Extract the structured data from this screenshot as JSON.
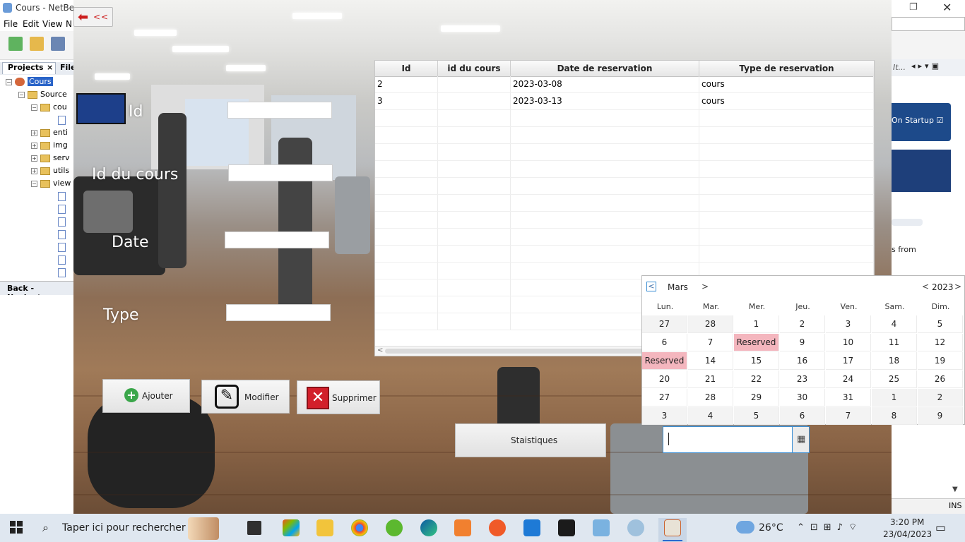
{
  "netbeans": {
    "title": "Cours - NetBeans",
    "menu": [
      "File",
      "Edit",
      "View",
      "N"
    ],
    "tabs": {
      "projects": "Projects",
      "files": "File"
    },
    "tree": {
      "root": "Cours",
      "source": "Source",
      "packages": [
        "cou",
        "enti",
        "img",
        "serv",
        "utils",
        "view"
      ]
    },
    "navigator": "Back - Navigator",
    "right_tab": "It...",
    "startpage_startup": "On Startup",
    "startpage_from": "s from",
    "ins": "INS"
  },
  "app": {
    "back_label": "<<",
    "form": {
      "id_label": "Id",
      "id_cours_label": "Id du cours",
      "date_label": "Date",
      "type_label": "Type",
      "id_value": "",
      "id_cours_value": "",
      "date_value": "",
      "type_value": ""
    },
    "buttons": {
      "add": "Ajouter",
      "edit": "Modifier",
      "delete": "Supprimer",
      "stats": "Staistiques"
    },
    "table": {
      "columns": [
        "Id",
        "id du cours",
        "Date de reservation",
        "Type de reservation"
      ],
      "rows": [
        [
          "2",
          "",
          "2023-03-08",
          "cours"
        ],
        [
          "3",
          "",
          "2023-03-13",
          "cours"
        ]
      ]
    },
    "datepicker": {
      "value": ""
    },
    "calendar": {
      "month": "Mars",
      "year": "2023",
      "days_of_week": [
        "Lun.",
        "Mar.",
        "Mer.",
        "Jeu.",
        "Ven.",
        "Sam.",
        "Dim."
      ],
      "weeks": [
        [
          "27",
          "28",
          "1",
          "2",
          "3",
          "4",
          "5"
        ],
        [
          "6",
          "7",
          "Reserved",
          "9",
          "10",
          "11",
          "12"
        ],
        [
          "Reserved",
          "14",
          "15",
          "16",
          "17",
          "18",
          "19"
        ],
        [
          "20",
          "21",
          "22",
          "23",
          "24",
          "25",
          "26"
        ],
        [
          "27",
          "28",
          "29",
          "30",
          "31",
          "1",
          "2"
        ],
        [
          "3",
          "4",
          "5",
          "6",
          "7",
          "8",
          "9"
        ]
      ],
      "reserved_color": "#f4b6be"
    }
  },
  "taskbar": {
    "search_placeholder": "Taper ici pour rechercher",
    "weather": "26°C",
    "time": "3:20 PM",
    "date": "23/04/2023"
  }
}
